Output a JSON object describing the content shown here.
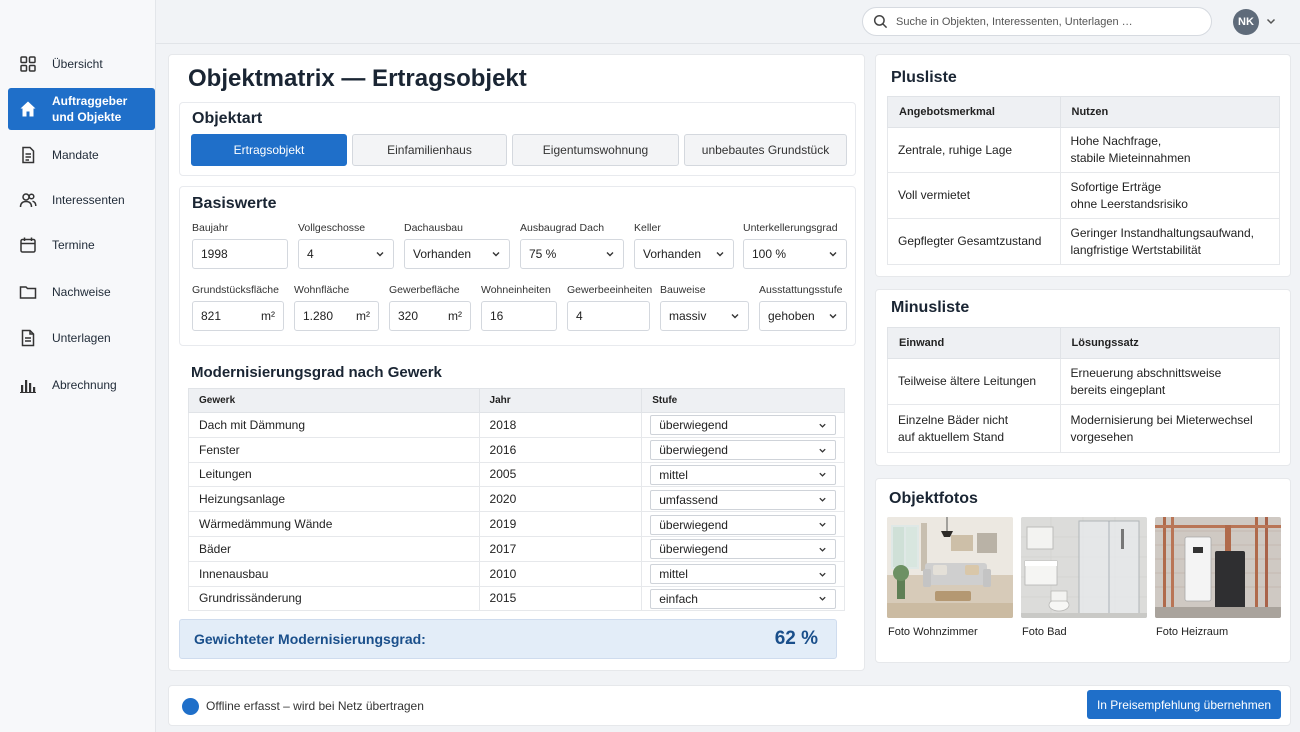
{
  "nav": {
    "items": [
      {
        "label": "Übersicht",
        "icon": "grid-icon"
      },
      {
        "label": "Auftraggeber und Objekte",
        "icon": "home-icon"
      },
      {
        "label": "Mandate",
        "icon": "document-icon"
      },
      {
        "label": "Interessenten",
        "icon": "users-icon"
      },
      {
        "label": "Termine",
        "icon": "calendar-icon"
      },
      {
        "label": "Nachweise",
        "icon": "folder-icon"
      },
      {
        "label": "Unterlagen",
        "icon": "file-text-icon"
      },
      {
        "label": "Abrechnung",
        "icon": "bar-chart-icon"
      }
    ],
    "active_index": 1
  },
  "topbar": {
    "search_placeholder": "Suche in Objekten, Interessenten, Unterlagen …",
    "avatar_initials": "NK"
  },
  "main": {
    "title": "Objektmatrix — Ertragsobjekt",
    "objektart": {
      "title": "Objektart",
      "options": [
        "Ertragsobjekt",
        "Einfamilienhaus",
        "Eigentumswohnung",
        "unbebautes Grundstück"
      ],
      "selected_index": 0
    },
    "basiswerte": {
      "title": "Basiswerte",
      "row1": [
        {
          "label": "Baujahr",
          "value": "1998",
          "type": "input"
        },
        {
          "label": "Vollgeschosse",
          "value": "4",
          "type": "select"
        },
        {
          "label": "Dachausbau",
          "value": "Vorhanden",
          "type": "select"
        },
        {
          "label": "Ausbaugrad Dach",
          "value": "75 %",
          "type": "select"
        },
        {
          "label": "Keller",
          "value": "Vorhanden",
          "type": "select"
        },
        {
          "label": "Unterkellerungsgrad",
          "value": "100 %",
          "type": "select"
        }
      ],
      "row2": [
        {
          "label": "Grundstücksfläche",
          "value": "821",
          "unit": "m²",
          "type": "input"
        },
        {
          "label": "Wohnfläche",
          "value": "1.280",
          "unit": "m²",
          "type": "input"
        },
        {
          "label": "Gewerbefläche",
          "value": "320",
          "unit": "m²",
          "type": "input"
        },
        {
          "label": "Wohneinheiten",
          "value": "16",
          "type": "input"
        },
        {
          "label": "Gewerbeeinheiten",
          "value": "4",
          "type": "input"
        },
        {
          "label": "Bauweise",
          "value": "massiv",
          "type": "select"
        },
        {
          "label": "Ausstattungsstufe",
          "value": "gehoben",
          "type": "select"
        }
      ]
    },
    "modernisierung": {
      "title": "Modernisierungsgrad nach Gewerk",
      "columns": [
        "Gewerk",
        "Jahr",
        "Stufe"
      ],
      "rows": [
        {
          "gewerk": "Dach mit Dämmung",
          "jahr": "2018",
          "stufe": "überwiegend"
        },
        {
          "gewerk": "Fenster",
          "jahr": "2016",
          "stufe": "überwiegend"
        },
        {
          "gewerk": "Leitungen",
          "jahr": "2005",
          "stufe": "mittel"
        },
        {
          "gewerk": "Heizungsanlage",
          "jahr": "2020",
          "stufe": "umfassend"
        },
        {
          "gewerk": "Wärmedämmung Wände",
          "jahr": "2019",
          "stufe": "überwiegend"
        },
        {
          "gewerk": "Bäder",
          "jahr": "2017",
          "stufe": "überwiegend"
        },
        {
          "gewerk": "Innenausbau",
          "jahr": "2010",
          "stufe": "mittel"
        },
        {
          "gewerk": "Grundrissänderung",
          "jahr": "2015",
          "stufe": "einfach"
        }
      ],
      "weighted_label": "Gewichteter Modernisierungsgrad:",
      "weighted_value": "62 %"
    }
  },
  "plusliste": {
    "title": "Plusliste",
    "columns": [
      "Angebotsmerkmal",
      "Nutzen"
    ],
    "rows": [
      {
        "merkmal": "Zentrale, ruhige Lage",
        "nutzen_1": "Hohe Nachfrage,",
        "nutzen_2": "stabile Mieteinnahmen"
      },
      {
        "merkmal": "Voll vermietet",
        "nutzen_1": "Sofortige Erträge",
        "nutzen_2": "ohne Leerstandsrisiko"
      },
      {
        "merkmal": "Gepflegter Gesamtzustand",
        "nutzen_1": "Geringer Instandhaltungsaufwand,",
        "nutzen_2": "langfristige Wertstabilität"
      }
    ]
  },
  "minusliste": {
    "title": "Minusliste",
    "columns": [
      "Einwand",
      "Lösungssatz"
    ],
    "rows": [
      {
        "einwand_1": "Teilweise ältere Leitungen",
        "einwand_2": "",
        "loesung_1": "Erneuerung abschnittsweise",
        "loesung_2": "bereits eingeplant"
      },
      {
        "einwand_1": "Einzelne Bäder nicht",
        "einwand_2": "auf aktuellem Stand",
        "loesung_1": "Modernisierung bei Mieterwechsel",
        "loesung_2": "vorgesehen"
      }
    ]
  },
  "objektfotos": {
    "title": "Objektfotos",
    "photos": [
      {
        "caption": "Foto Wohnzimmer"
      },
      {
        "caption": "Foto Bad"
      },
      {
        "caption": "Foto Heizraum"
      }
    ]
  },
  "bottombar": {
    "status_text": "Offline erfasst – wird bei Netz übertragen",
    "primary_button": "In Preisempfehlung übernehmen"
  },
  "colors": {
    "accent": "#1f6fc9",
    "highlight_bg": "#e3edf8",
    "highlight_text": "#1a4f8b"
  }
}
